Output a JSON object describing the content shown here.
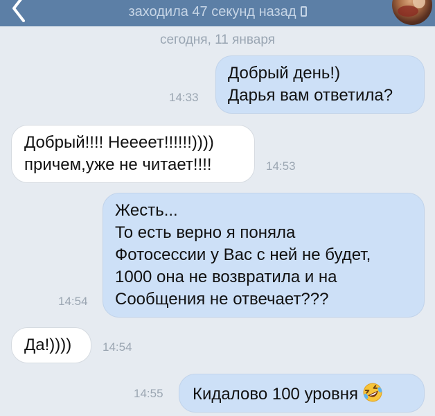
{
  "header": {
    "status": "заходила 47 секунд назад"
  },
  "date_separator": "сегодня, 11 января",
  "messages": [
    {
      "direction": "out",
      "lines": [
        "Добрый день!)",
        "Дарья вам ответила?"
      ],
      "time": "14:33"
    },
    {
      "direction": "in",
      "lines": [
        "Добрый!!!! Неееет!!!!!!))))",
        "причем,уже не читает!!!!"
      ],
      "time": "14:53"
    },
    {
      "direction": "out",
      "lines": [
        "Жесть...",
        "То есть верно я поняла",
        "Фотосессии у Вас с ней не будет,",
        "1000 она не возвратила и на",
        "Сообщения не отвечает???"
      ],
      "time": "14:54"
    },
    {
      "direction": "in",
      "lines": [
        "Да!))))"
      ],
      "time": "14:54"
    },
    {
      "direction": "out",
      "lines": [
        "Кидалово 100 уровня"
      ],
      "emoji": "rolling-on-floor-laughing-emoji",
      "time": "14:55"
    }
  ],
  "colors": {
    "background": "#e6ebf1",
    "header": "#5c7fa6",
    "outgoing_bubble": "#cde0f7",
    "incoming_bubble": "#ffffff",
    "timestamp": "#9ba6b2"
  }
}
